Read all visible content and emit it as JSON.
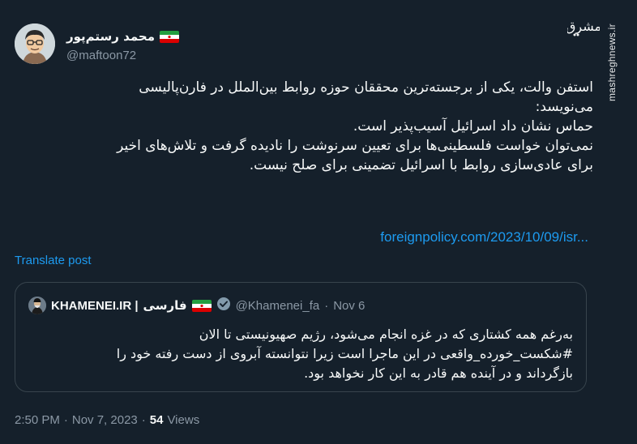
{
  "author": {
    "display_name": "محمد رستم‌پور",
    "handle": "@maftoon72",
    "flag_icon": "iran-flag-icon"
  },
  "watermark": {
    "logo_text": "مشرق",
    "site": "mashreghnews.ir"
  },
  "tweet": {
    "lines": [
      "استفن والت، یکی از برجسته‌ترین محققان حوزه روابط بین‌الملل در فارن‌پالیسی",
      "می‌نویسد:",
      "حماس نشان داد اسرائیل آسیب‌پذیر است.",
      "نمی‌توان خواست فلسطینی‌ها برای تعیین سرنوشت را نادیده گرفت و تلاش‌های اخیر",
      "برای عادی‌سازی روابط با اسرائیل  تضمینی برای صلح نیست."
    ],
    "link": "foreignpolicy.com/2023/10/09/isr...",
    "translate_label": "Translate post"
  },
  "quote": {
    "name": "KHAMENEI.IR |",
    "name_fa": "فارسی",
    "handle": "@Khamenei_fa",
    "separator": "·",
    "date": "Nov 6",
    "lines": [
      "به‌رغم همه کشتاری که در غزه انجام می‌شود، رژیم صهیونیستی تا الان",
      "#شکست_خورده_واقعی در این ماجرا است زیرا نتوانسته آبروی از دست رفته خود را",
      "بازگرداند و در آینده هم قادر به این کار نخواهد بود."
    ]
  },
  "meta": {
    "time": "2:50 PM",
    "dot1": "·",
    "date": "Nov 7, 2023",
    "dot2": "·",
    "views_count": "54",
    "views_label": "Views"
  },
  "colors": {
    "background": "#15202b",
    "link": "#1d9bf0",
    "muted": "#8b98a5",
    "border": "#38444d"
  }
}
